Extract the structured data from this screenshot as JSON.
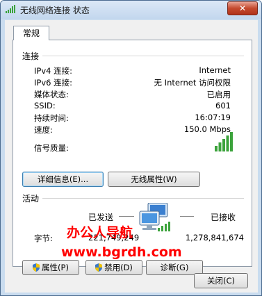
{
  "window": {
    "title": "无线网络连接 状态",
    "close_label": "✕"
  },
  "tabs": [
    {
      "label": "常规"
    }
  ],
  "connection": {
    "section_title": "连接",
    "rows": [
      {
        "label": "IPv4 连接:",
        "value": "Internet"
      },
      {
        "label": "IPv6 连接:",
        "value": "无 Internet 访问权限"
      },
      {
        "label": "媒体状态:",
        "value": "已启用"
      },
      {
        "label": "SSID:",
        "value": "601"
      },
      {
        "label": "持续时间:",
        "value": "16:07:19"
      },
      {
        "label": "速度:",
        "value": "150.0 Mbps"
      }
    ],
    "signal_label": "信号质量:",
    "signal_bars_filled": 5,
    "signal_bars_total": 5,
    "details_button": "详细信息(E)...",
    "wireless_props_button": "无线属性(W)"
  },
  "activity": {
    "section_title": "活动",
    "sent_label": "已发送",
    "received_label": "已接收",
    "bytes_label": "字节:",
    "bytes_sent": "221,749,249",
    "bytes_received": "1,278,841,674",
    "properties_button": "属性(P)",
    "disable_button": "禁用(D)",
    "diagnose_button": "诊断(G)"
  },
  "close_button": "关闭(C)",
  "watermark": {
    "line1": "办公人导航",
    "line2": "www.bgrdh.com"
  },
  "colors": {
    "signal": "#3ca33c",
    "titlebar": "#c3d7ee",
    "watermark": "#ff0000"
  }
}
